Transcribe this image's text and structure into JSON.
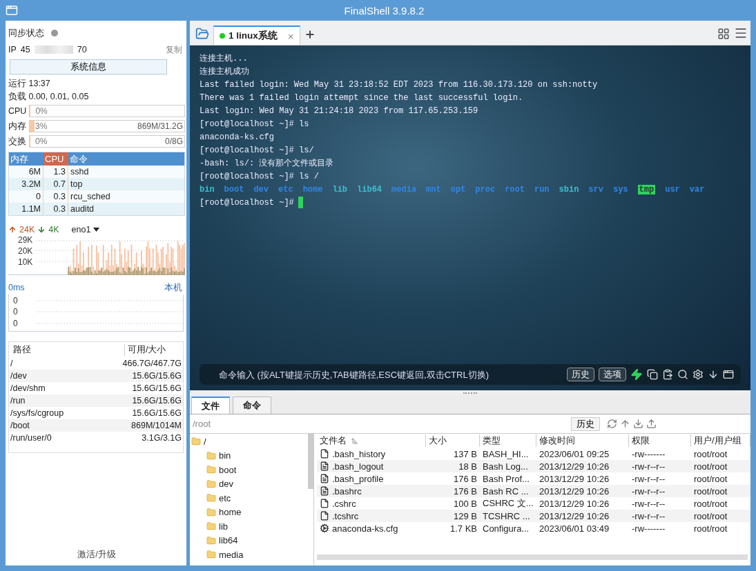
{
  "window": {
    "title": "FinalShell 3.9.8.2"
  },
  "sidebar": {
    "sync_label": "同步状态",
    "sync_on": false,
    "ip_label": "IP",
    "ip_start": "45",
    "ip_end": "70",
    "copy_link": "复制",
    "sysinfo_button": "系统信息",
    "uptime": "运行 13:37",
    "load": "负载 0.00, 0.01, 0.05",
    "meters": [
      {
        "label": "CPU",
        "percent": "0%",
        "level": 0
      },
      {
        "label": "内存",
        "percent": "3%",
        "level": 0.03,
        "detail": "869M/31.2G"
      },
      {
        "label": "交换",
        "percent": "0%",
        "level": 0,
        "detail": "0/8G"
      }
    ],
    "process_columns": [
      {
        "label": "内存",
        "selected": false
      },
      {
        "label": "CPU",
        "selected": true
      },
      {
        "label": "命令",
        "selected": false
      }
    ],
    "processes": [
      [
        "6M",
        "1.3",
        "sshd"
      ],
      [
        "3.2M",
        "0.7",
        "top"
      ],
      [
        "0",
        "0.3",
        "rcu_sched"
      ],
      [
        "1.1M",
        "0.3",
        "auditd"
      ]
    ],
    "network": {
      "upload": "24K",
      "download": "4K",
      "interface": "eno1",
      "y_labels": [
        "29K",
        "20K",
        "10K"
      ]
    },
    "ping": {
      "latency": "0ms",
      "target": "本机",
      "y_labels": [
        "0",
        "0",
        "0"
      ]
    },
    "disk_columns": [
      "路径",
      "可用/大小"
    ],
    "disks": [
      [
        "/",
        "466.7G/467.7G"
      ],
      [
        "/dev",
        "15.6G/15.6G"
      ],
      [
        "/dev/shm",
        "15.6G/15.6G"
      ],
      [
        "/run",
        "15.6G/15.6G"
      ],
      [
        "/sys/fs/cgroup",
        "15.6G/15.6G"
      ],
      [
        "/boot",
        "869M/1014M"
      ],
      [
        "/run/user/0",
        "3.1G/3.1G"
      ]
    ],
    "activate_link": "激活/升级"
  },
  "session_tabs": [
    {
      "label": "1 linux系统",
      "selected": true,
      "connected": true,
      "close": "×"
    }
  ],
  "terminal": {
    "lines": [
      "连接主机...",
      "连接主机成功",
      "Last failed login: Wed May 31 23:18:52 EDT 2023 from 116.30.173.120 on ssh:notty",
      "There was 1 failed login attempt since the last successful login.",
      "Last login: Wed May 31 21:24:18 2023 from 117.65.253.159",
      "[root@localhost ~]# ls",
      "anaconda-ks.cfg",
      "[root@localhost ~]# ls/",
      "-bash: ls/: 没有那个文件或目录",
      "[root@localhost ~]# ls /"
    ],
    "listing": [
      {
        "name": "bin",
        "kind": "link"
      },
      {
        "name": "boot",
        "kind": "dir"
      },
      {
        "name": "dev",
        "kind": "dir"
      },
      {
        "name": "etc",
        "kind": "dir"
      },
      {
        "name": "home",
        "kind": "dir"
      },
      {
        "name": "lib",
        "kind": "link"
      },
      {
        "name": "lib64",
        "kind": "link"
      },
      {
        "name": "media",
        "kind": "dir"
      },
      {
        "name": "mnt",
        "kind": "dir"
      },
      {
        "name": "opt",
        "kind": "dir"
      },
      {
        "name": "proc",
        "kind": "dir"
      },
      {
        "name": "root",
        "kind": "dir"
      },
      {
        "name": "run",
        "kind": "dir"
      },
      {
        "name": "sbin",
        "kind": "link"
      },
      {
        "name": "srv",
        "kind": "dir"
      },
      {
        "name": "sys",
        "kind": "dir"
      },
      {
        "name": "tmp",
        "kind": "sticky"
      },
      {
        "name": "usr",
        "kind": "dir"
      },
      {
        "name": "var",
        "kind": "dir"
      }
    ],
    "prompt": "[root@localhost ~]#"
  },
  "command_bar": {
    "placeholder": "命令输入 (按ALT键提示历史,TAB键路径,ESC键返回,双击CTRL切换)",
    "buttons": [
      "历史",
      "选项"
    ]
  },
  "file_tabs": [
    {
      "label": "文件",
      "selected": true
    },
    {
      "label": "命令",
      "selected": false
    }
  ],
  "path_bar": {
    "path": "/root",
    "history_button": "历史"
  },
  "tree": {
    "label": "/",
    "children": [
      {
        "label": "bin"
      },
      {
        "label": "boot"
      },
      {
        "label": "dev"
      },
      {
        "label": "etc"
      },
      {
        "label": "home"
      },
      {
        "label": "lib"
      },
      {
        "label": "lib64"
      },
      {
        "label": "media"
      }
    ]
  },
  "file_table": {
    "columns": [
      {
        "label": "文件名",
        "sorted": true
      },
      {
        "label": "大小",
        "sorted": false
      },
      {
        "label": "类型",
        "sorted": false
      },
      {
        "label": "修改时间",
        "sorted": false
      },
      {
        "label": "权限",
        "sorted": false
      },
      {
        "label": "用户/用户组",
        "sorted": false
      }
    ],
    "rows": [
      {
        "kind": "blank",
        "cells": [
          ".bash_history",
          "137 B",
          "BASH_HI...",
          "2023/06/01 09:25",
          "-rw-------",
          "root/root"
        ]
      },
      {
        "kind": "script",
        "cells": [
          ".bash_logout",
          "18 B",
          "Bash Log...",
          "2013/12/29 10:26",
          "-rw-r--r--",
          "root/root"
        ]
      },
      {
        "kind": "script",
        "cells": [
          ".bash_profile",
          "176 B",
          "Bash Prof...",
          "2013/12/29 10:26",
          "-rw-r--r--",
          "root/root"
        ]
      },
      {
        "kind": "script",
        "cells": [
          ".bashrc",
          "176 B",
          "Bash RC ...",
          "2013/12/29 10:26",
          "-rw-r--r--",
          "root/root"
        ]
      },
      {
        "kind": "blank",
        "cells": [
          ".cshrc",
          "100 B",
          "CSHRC 文...",
          "2013/12/29 10:26",
          "-rw-r--r--",
          "root/root"
        ]
      },
      {
        "kind": "blank",
        "cells": [
          ".tcshrc",
          "129 B",
          "TCSHRC ...",
          "2013/12/29 10:26",
          "-rw-r--r--",
          "root/root"
        ]
      },
      {
        "kind": "config",
        "cells": [
          "anaconda-ks.cfg",
          "1.7 KB",
          "Configura...",
          "2023/06/01 03:49",
          "-rw-------",
          "root/root"
        ]
      }
    ]
  }
}
